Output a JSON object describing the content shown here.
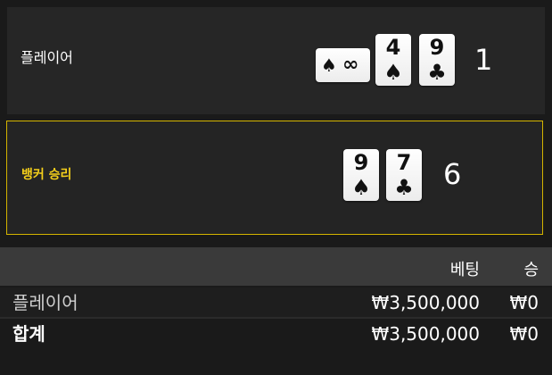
{
  "player": {
    "label": "플레이어",
    "score": "1",
    "cards": [
      {
        "rank": "∞",
        "suit": "♠",
        "rotated": true
      },
      {
        "rank": "4",
        "suit": "♠"
      },
      {
        "rank": "9",
        "suit": "♣"
      }
    ]
  },
  "banker": {
    "label": "뱅커 승리",
    "score": "6",
    "cards": [
      {
        "rank": "9",
        "suit": "♠"
      },
      {
        "rank": "7",
        "suit": "♣"
      }
    ]
  },
  "table": {
    "header_bet": "베팅",
    "header_win": "승",
    "rows": [
      {
        "label": "플레이어",
        "bet": "₩3,500,000",
        "win": "₩0"
      },
      {
        "label": "합계",
        "bet": "₩3,500,000",
        "win": "₩0"
      }
    ]
  },
  "colors": {
    "banker_accent": "#f5cf1b",
    "panel": "#262626",
    "background": "#1a1a1a"
  }
}
